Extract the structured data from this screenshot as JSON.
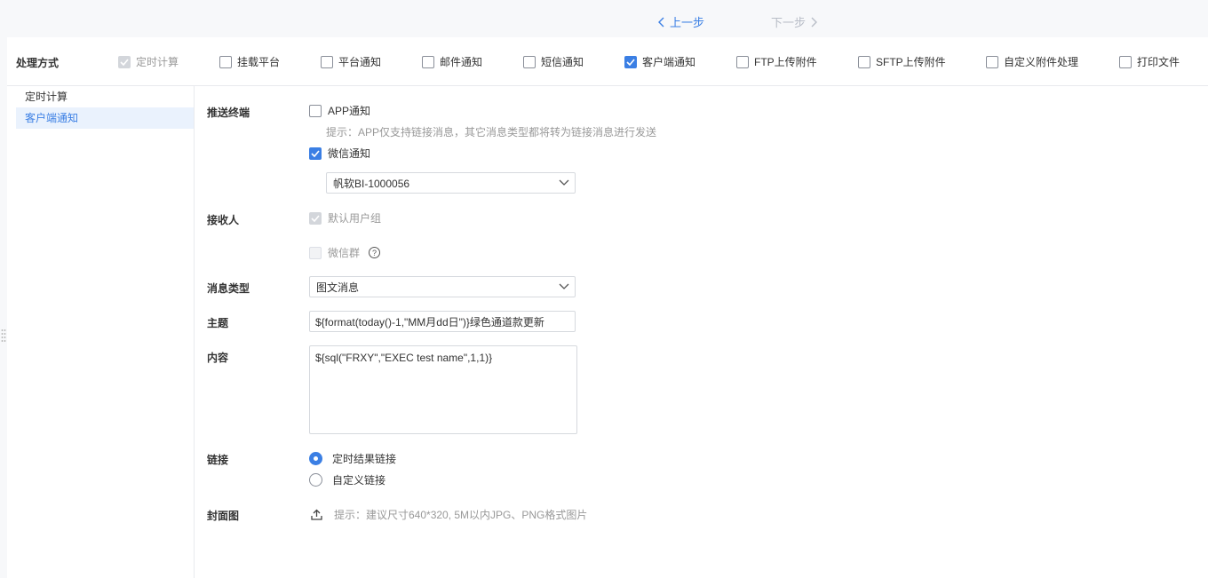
{
  "nav": {
    "prev_label": "上一步",
    "next_label": "下一步"
  },
  "method": {
    "label": "处理方式",
    "options": [
      {
        "label": "定时计算",
        "checked": true,
        "disabled": true
      },
      {
        "label": "挂载平台",
        "checked": false
      },
      {
        "label": "平台通知",
        "checked": false
      },
      {
        "label": "邮件通知",
        "checked": false
      },
      {
        "label": "短信通知",
        "checked": false
      },
      {
        "label": "客户端通知",
        "checked": true
      },
      {
        "label": "FTP上传附件",
        "checked": false
      },
      {
        "label": "SFTP上传附件",
        "checked": false
      },
      {
        "label": "自定义附件处理",
        "checked": false
      },
      {
        "label": "打印文件",
        "checked": false
      }
    ]
  },
  "sidebar": {
    "items": [
      {
        "label": "定时计算",
        "active": false
      },
      {
        "label": "客户端通知",
        "active": true
      }
    ]
  },
  "form": {
    "push_terminal": {
      "label": "推送终端",
      "app_label": "APP通知",
      "app_hint": "提示：APP仅支持链接消息，其它消息类型都将转为链接消息进行发送",
      "wechat_label": "微信通知",
      "wechat_account": "帆软BI-1000056"
    },
    "receiver": {
      "label": "接收人",
      "default_group_label": "默认用户组",
      "wechat_group_label": "微信群",
      "help_glyph": "?"
    },
    "message_type": {
      "label": "消息类型",
      "value": "图文消息"
    },
    "subject": {
      "label": "主题",
      "value": "${format(today()-1,\"MM月dd日\")}绿色通道款更新"
    },
    "content": {
      "label": "内容",
      "value": "${sql(\"FRXY\",\"EXEC test name\",1,1)}"
    },
    "link": {
      "label": "链接",
      "options": [
        {
          "label": "定时结果链接",
          "selected": true
        },
        {
          "label": "自定义链接",
          "selected": false
        }
      ]
    },
    "cover": {
      "label": "封面图",
      "hint": "提示：建议尺寸640*320, 5M以内JPG、PNG格式图片"
    }
  },
  "colors": {
    "accent": "#3b7fe4",
    "disabled_text": "#999999",
    "border": "#d6d9de"
  }
}
